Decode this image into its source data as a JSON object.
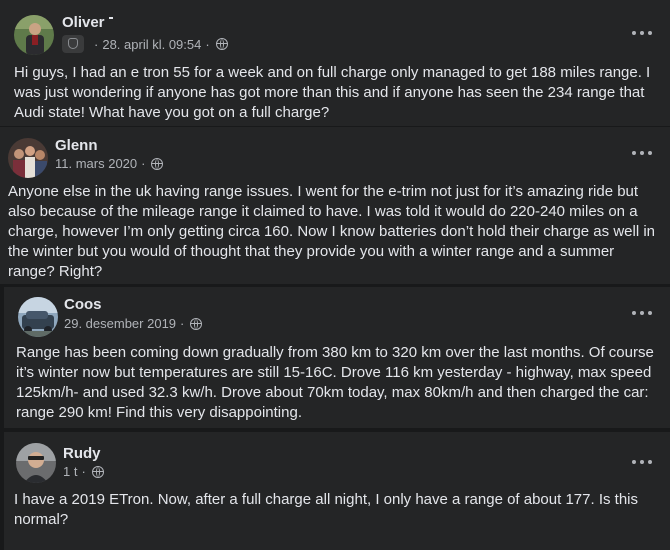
{
  "posts": [
    {
      "author": "Oliver",
      "timestamp": "28. april kl. 09:54",
      "has_badge": true,
      "body": "Hi guys, I had an e tron 55 for a week and on full charge only managed to get 188 miles range. I was just wondering if anyone has got more than this and if anyone has seen the 234 range that Audi state! What have you got on a full charge?"
    },
    {
      "author": "Glenn",
      "timestamp": "11. mars 2020",
      "body": "Anyone else in the uk having range issues. I went for the e-trim not just for it’s amazing ride but also because of the mileage range it claimed to have. I was told it would do 220-240 miles on a charge, however I’m only getting circa 160. Now I know batteries don’t hold their charge as well in the winter but you would of thought that they provide you with a winter range and a summer range? Right?"
    },
    {
      "author": "Coos",
      "timestamp": "29. desember 2019",
      "body": "Range has been coming down gradually from 380 km to 320 km over the last months. Of course it’s winter now but temperatures are still 15-16C. Drove 116 km yesterday - highway, max speed 125km/h- and used 32.3 kw/h. Drove about 70km today, max 80km/h and then charged the car: range 290 km! Find this very disappointing."
    },
    {
      "author": "Rudy",
      "timestamp": "1 t",
      "body": "I have a 2019 ETron. Now, after a full charge all night, I only have a range of about 177. Is this normal?"
    }
  ],
  "separator": "·",
  "icons": {
    "privacy": "globe-icon",
    "menu": "more-options-icon"
  },
  "colors": {
    "background": "#18191a",
    "card": "#242526",
    "primary_text": "#e4e6eb",
    "secondary_text": "#b0b3b8"
  }
}
